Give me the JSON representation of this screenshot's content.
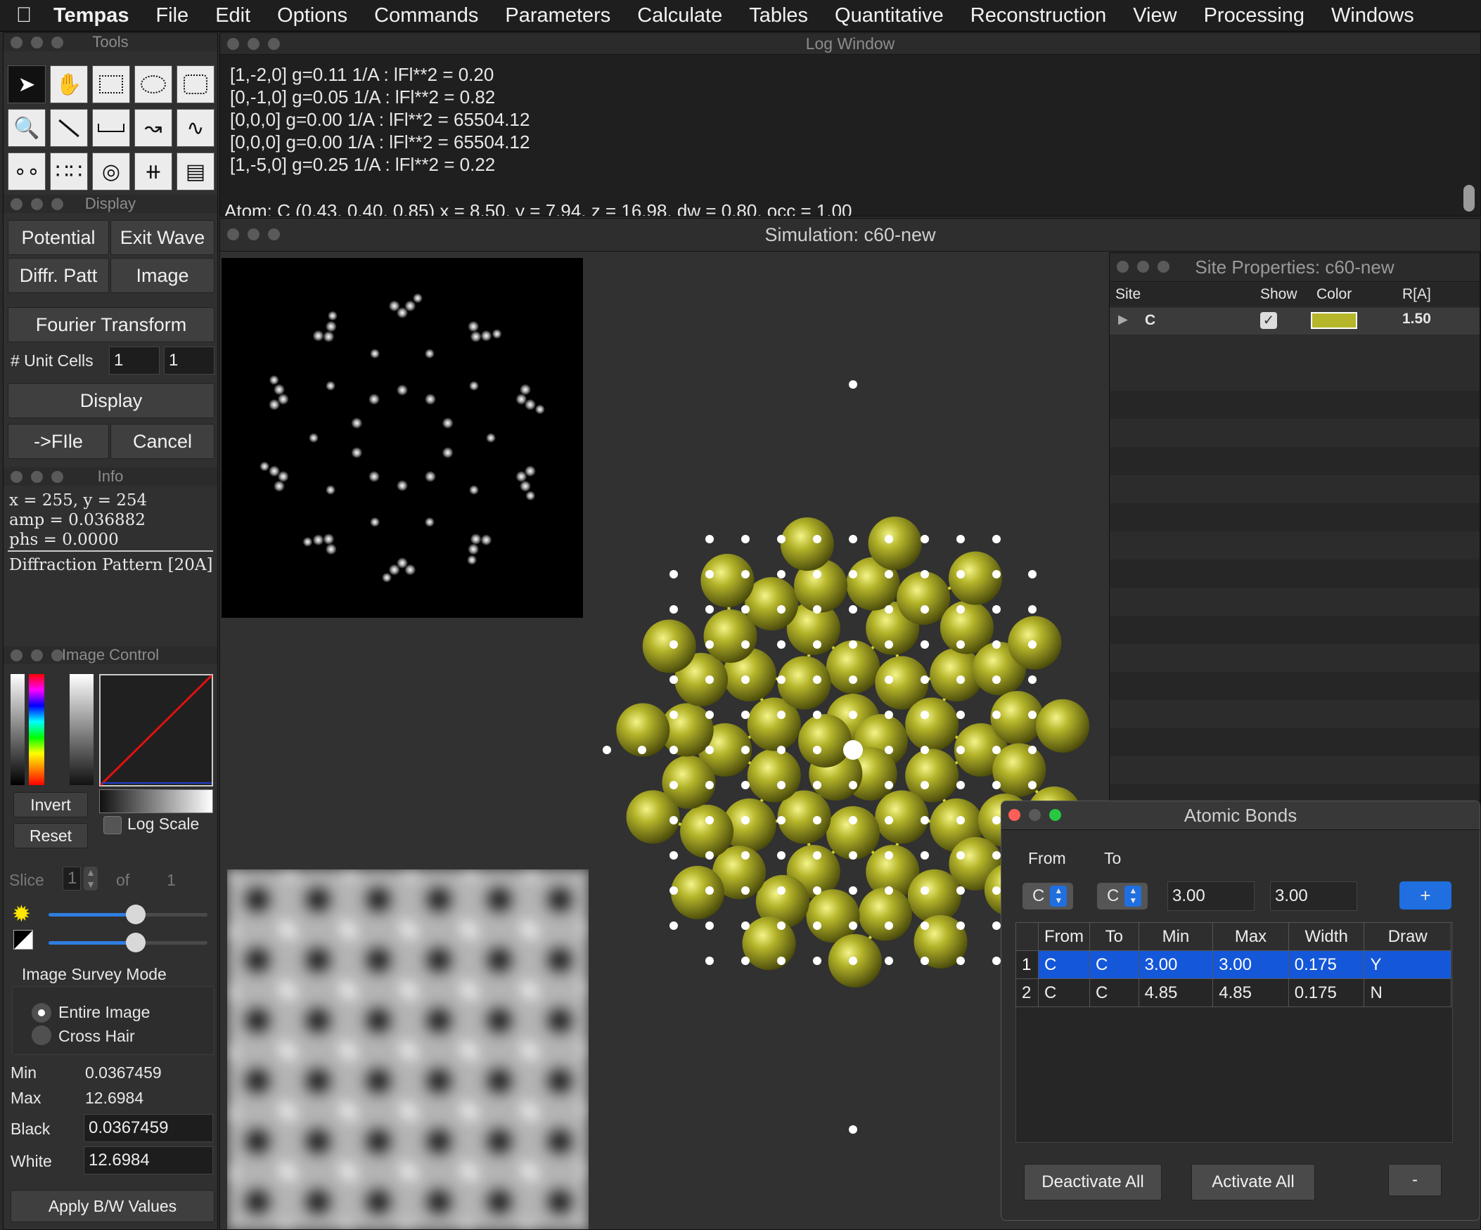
{
  "menubar": {
    "app": "Tempas",
    "items": [
      "File",
      "Edit",
      "Options",
      "Commands",
      "Parameters",
      "Calculate",
      "Tables",
      "Quantitative",
      "Reconstruction",
      "View",
      "Processing",
      "Windows"
    ]
  },
  "tools_panel": {
    "title": "Tools"
  },
  "display_panel": {
    "title": "Display",
    "potential": "Potential",
    "exit_wave": "Exit Wave",
    "diffr_patt": "Diffr. Patt",
    "image": "Image",
    "fourier": "Fourier Transform",
    "unit_cells_label": "# Unit Cells",
    "unit_cells_a": "1",
    "unit_cells_b": "1",
    "display": "Display",
    "to_file": "->FIle",
    "cancel": "Cancel"
  },
  "info_panel": {
    "title": "Info",
    "xy": "x = 255, y = 254",
    "amp": "amp = 0.036882",
    "phs": "phs = 0.0000",
    "desc": "Diffraction Pattern [20A]"
  },
  "image_control": {
    "title": "Image Control",
    "invert": "Invert",
    "reset": "Reset",
    "log_scale": "Log Scale",
    "slice_label": "Slice",
    "slice_value": "1",
    "of_label": "of",
    "slice_total": "1",
    "brightness_level": 0.55,
    "contrast_level": 0.55,
    "survey_mode_label": "Image Survey Mode",
    "mode_entire": "Entire Image",
    "mode_cross": "Cross Hair",
    "min_label": "Min",
    "min_value": "0.0367459",
    "max_label": "Max",
    "max_value": "12.6984",
    "black_label": "Black",
    "black_value": "0.0367459",
    "white_label": "White",
    "white_value": "12.6984",
    "apply": "Apply B/W Values"
  },
  "log_window": {
    "title": "Log Window",
    "lines": [
      "[1,-2,0] g=0.11 1/A : lFl**2 = 0.20",
      "[0,-1,0] g=0.05 1/A : lFl**2 = 0.82",
      "[0,0,0] g=0.00 1/A : lFl**2 = 65504.12",
      "[0,0,0] g=0.00 1/A : lFl**2 = 65504.12",
      "[1,-5,0] g=0.25 1/A : lFl**2 = 0.22"
    ],
    "atom_line": "Atom: C (0.43, 0.40, 0.85) x = 8.50, y = 7.94, z = 16.98, dw = 0.80, occ = 1.00"
  },
  "simulation": {
    "title": "Simulation: c60-new"
  },
  "site_props": {
    "title": "Site Properties: c60-new",
    "headers": [
      "Site",
      "Show",
      "Color",
      "R[A]"
    ],
    "row": {
      "site": "C",
      "show": "✓",
      "color": "#b5b62a",
      "radius": "1.50"
    }
  },
  "atomic_bonds": {
    "title": "Atomic Bonds",
    "from_label": "From",
    "to_label": "To",
    "from_sel": "C",
    "to_sel": "C",
    "min_input": "3.00",
    "max_input": "3.00",
    "add": "+",
    "headers": [
      "From",
      "To",
      "Min",
      "Max",
      "Width",
      "Draw"
    ],
    "rows": [
      {
        "n": "1",
        "from": "C",
        "to": "C",
        "min": "3.00",
        "max": "3.00",
        "width": "0.175",
        "draw": "Y"
      },
      {
        "n": "2",
        "from": "C",
        "to": "C",
        "min": "4.85",
        "max": "4.85",
        "width": "0.175",
        "draw": "N"
      }
    ],
    "deactivate": "Deactivate All",
    "activate": "Activate All",
    "remove": "-"
  },
  "colors": {
    "atom": "#a8a820",
    "bond": "#d4d43a",
    "selection": "#1457d9",
    "close": "#ff5f57",
    "zoom": "#28c840"
  }
}
